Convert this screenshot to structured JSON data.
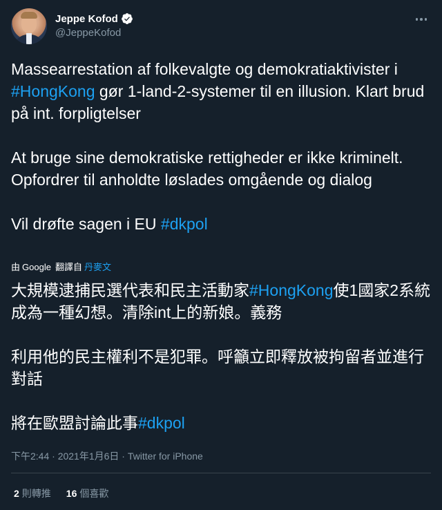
{
  "user": {
    "display_name": "Jeppe Kofod",
    "handle": "@JeppeKofod",
    "verified": true
  },
  "tweet": {
    "paragraphs": [
      [
        {
          "text": "Massearrestation af folkevalgte og demokratiaktivister i "
        },
        {
          "text": "#HongKong",
          "hashtag": true
        },
        {
          "text": " gør 1-land-2-systemer til en illusion. Klart brud på int. forpligtelser"
        }
      ],
      [
        {
          "text": "At bruge sine demokratiske rettigheder er ikke kriminelt. Opfordrer til anholdte løslades omgående og dialog"
        }
      ],
      [
        {
          "text": "Vil drøfte sagen i EU "
        },
        {
          "text": "#dkpol",
          "hashtag": true
        }
      ]
    ]
  },
  "translation": {
    "by": "由",
    "provider": "Google",
    "action": "翻譯自",
    "source_language": "丹麥文",
    "paragraphs": [
      [
        {
          "text": "大規模逮捕民選代表和民主活動家"
        },
        {
          "text": "#HongKong",
          "hashtag": true
        },
        {
          "text": "使1國家2系統成為一種幻想。清除int上的新娘。義務"
        }
      ],
      [
        {
          "text": "利用他的民主權利不是犯罪。呼籲立即釋放被拘留者並進行對話"
        }
      ],
      [
        {
          "text": "將在歐盟討論此事"
        },
        {
          "text": "#dkpol",
          "hashtag": true
        }
      ]
    ]
  },
  "meta": {
    "time": "下午2:44",
    "separator": " · ",
    "date": "2021年1月6日",
    "source": "Twitter for iPhone"
  },
  "stats": {
    "retweets_count": "2",
    "retweets_label": "則轉推",
    "likes_count": "16",
    "likes_label": "個喜歡"
  },
  "colors": {
    "background": "#15202b",
    "accent": "#1da1f2",
    "secondary_text": "#8899a6",
    "divider": "#38444d"
  },
  "icons": {
    "verified": "verified-badge-icon",
    "more": "more-dots-icon",
    "translate": "translate-icon"
  }
}
